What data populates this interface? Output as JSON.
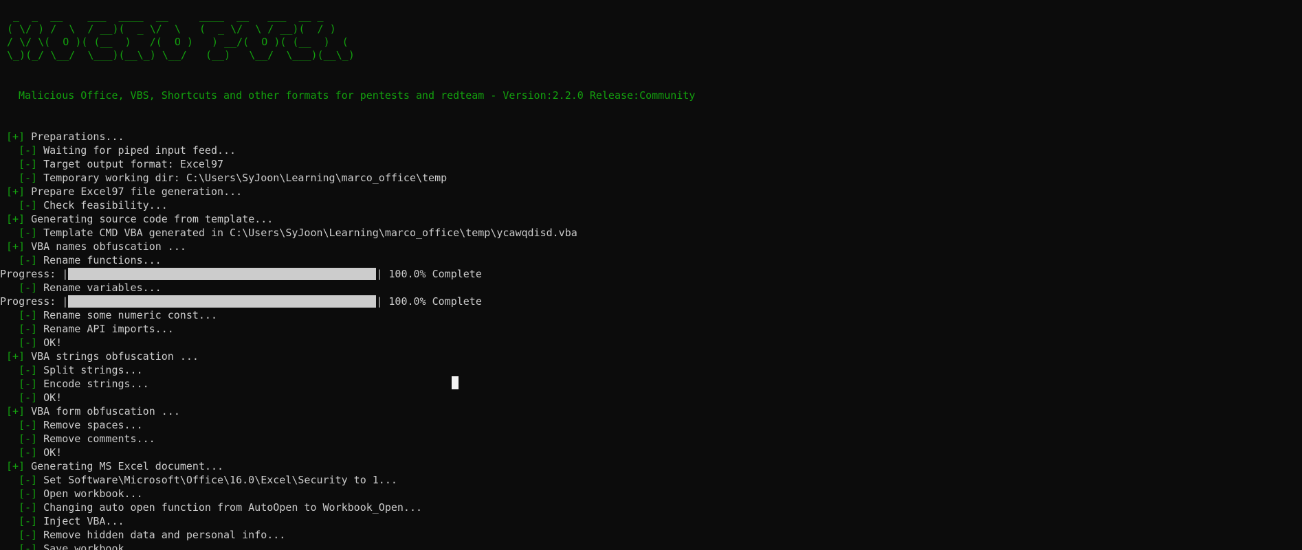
{
  "colors": {
    "background": "#0c0c0c",
    "text": "#cccccc",
    "accent_green": "#13a10e",
    "cursor": "#f2f2f2",
    "progress_fill": "#cccccc"
  },
  "banner": {
    "ascii_art": " _  _  __    ___  ____  __     ____  __   ___  __ _\n( \\/ ) /  \\  / __)(  _ \\/  \\   (  _ \\/  \\ / __)(  / )\n/ \\/ \\(  O )( (__  )   /(  O )   ) __/(  O )( (__  )  (\n\\_)(_/ \\__/  \\___)(__\\_) \\__/   (__)   \\__/  \\___)(__\\_)",
    "tagline": "Malicious Office, VBS, Shortcuts and other formats for pentests and redteam - Version:2.2.0 Release:Community"
  },
  "log": [
    {
      "type": "text",
      "level": 1,
      "prefix": "[+]",
      "text": " Preparations..."
    },
    {
      "type": "text",
      "level": 2,
      "prefix": "[-]",
      "text": " Waiting for piped input feed..."
    },
    {
      "type": "text",
      "level": 2,
      "prefix": "[-]",
      "text": " Target output format: Excel97"
    },
    {
      "type": "text",
      "level": 2,
      "prefix": "[-]",
      "text": " Temporary working dir: C:\\Users\\SyJoon\\Learning\\marco_office\\temp"
    },
    {
      "type": "text",
      "level": 1,
      "prefix": "[+]",
      "text": " Prepare Excel97 file generation..."
    },
    {
      "type": "text",
      "level": 2,
      "prefix": "[-]",
      "text": " Check feasibility..."
    },
    {
      "type": "text",
      "level": 1,
      "prefix": "[+]",
      "text": " Generating source code from template..."
    },
    {
      "type": "text",
      "level": 2,
      "prefix": "[-]",
      "text": " Template CMD VBA generated in C:\\Users\\SyJoon\\Learning\\marco_office\\temp\\ycawqdisd.vba"
    },
    {
      "type": "text",
      "level": 1,
      "prefix": "[+]",
      "text": " VBA names obfuscation ..."
    },
    {
      "type": "text",
      "level": 2,
      "prefix": "[-]",
      "text": " Rename functions..."
    },
    {
      "type": "progress",
      "label": "Progress: |",
      "percent": 100,
      "suffix": "| 100.0% Complete"
    },
    {
      "type": "text",
      "level": 2,
      "prefix": "[-]",
      "text": " Rename variables..."
    },
    {
      "type": "progress",
      "label": "Progress: |",
      "percent": 100,
      "suffix": "| 100.0% Complete"
    },
    {
      "type": "text",
      "level": 2,
      "prefix": "[-]",
      "text": " Rename some numeric const..."
    },
    {
      "type": "text",
      "level": 2,
      "prefix": "[-]",
      "text": " Rename API imports..."
    },
    {
      "type": "text",
      "level": 2,
      "prefix": "[-]",
      "text": " OK!"
    },
    {
      "type": "text",
      "level": 1,
      "prefix": "[+]",
      "text": " VBA strings obfuscation ..."
    },
    {
      "type": "text",
      "level": 2,
      "prefix": "[-]",
      "text": " Split strings..."
    },
    {
      "type": "text",
      "level": 2,
      "prefix": "[-]",
      "text": " Encode strings..."
    },
    {
      "type": "text",
      "level": 2,
      "prefix": "[-]",
      "text": " OK!"
    },
    {
      "type": "text",
      "level": 1,
      "prefix": "[+]",
      "text": " VBA form obfuscation ..."
    },
    {
      "type": "text",
      "level": 2,
      "prefix": "[-]",
      "text": " Remove spaces..."
    },
    {
      "type": "text",
      "level": 2,
      "prefix": "[-]",
      "text": " Remove comments..."
    },
    {
      "type": "text",
      "level": 2,
      "prefix": "[-]",
      "text": " OK!"
    },
    {
      "type": "text",
      "level": 1,
      "prefix": "[+]",
      "text": " Generating MS Excel document..."
    },
    {
      "type": "text",
      "level": 2,
      "prefix": "[-]",
      "text": " Set Software\\Microsoft\\Office\\16.0\\Excel\\Security to 1..."
    },
    {
      "type": "text",
      "level": 2,
      "prefix": "[-]",
      "text": " Open workbook..."
    },
    {
      "type": "text",
      "level": 2,
      "prefix": "[-]",
      "text": " Changing auto open function from AutoOpen to Workbook_Open..."
    },
    {
      "type": "text",
      "level": 2,
      "prefix": "[-]",
      "text": " Inject VBA..."
    },
    {
      "type": "text",
      "level": 2,
      "prefix": "[-]",
      "text": " Remove hidden data and personal info..."
    },
    {
      "type": "text",
      "level": 2,
      "prefix": "[-]",
      "text": " Save workbook..."
    }
  ]
}
